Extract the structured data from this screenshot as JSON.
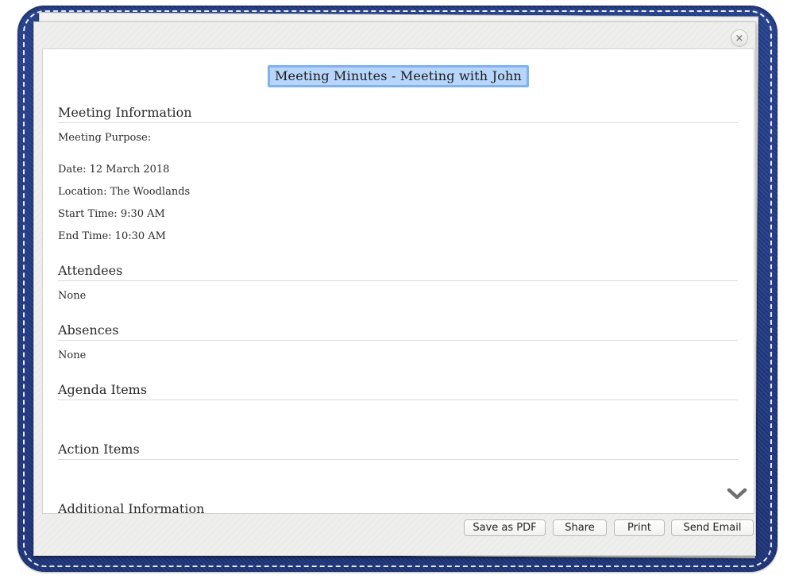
{
  "dialog": {
    "close_symbol": "×",
    "title": "Meeting Minutes - Meeting with John"
  },
  "sections": {
    "meeting_information": {
      "heading": "Meeting Information",
      "purpose": "Meeting Purpose:",
      "date": "Date: 12 March 2018",
      "location": "Location: The Woodlands",
      "start_time": "Start Time: 9:30 AM",
      "end_time": "End Time: 10:30 AM"
    },
    "attendees": {
      "heading": "Attendees",
      "value": "None"
    },
    "absences": {
      "heading": "Absences",
      "value": "None"
    },
    "agenda_items": {
      "heading": "Agenda Items"
    },
    "action_items": {
      "heading": "Action Items"
    },
    "additional_information": {
      "heading": "Additional Information"
    }
  },
  "toolbar": {
    "save_pdf_label": "Save as PDF",
    "share_label": "Share",
    "print_label": "Print",
    "send_email_label": "Send Email"
  },
  "icons": {
    "close": "close-icon",
    "scroll_down": "chevron-down-icon"
  },
  "colors": {
    "binder": "#233c88",
    "title_highlight": "#b8d6fb",
    "title_border": "#7fb2ef"
  }
}
